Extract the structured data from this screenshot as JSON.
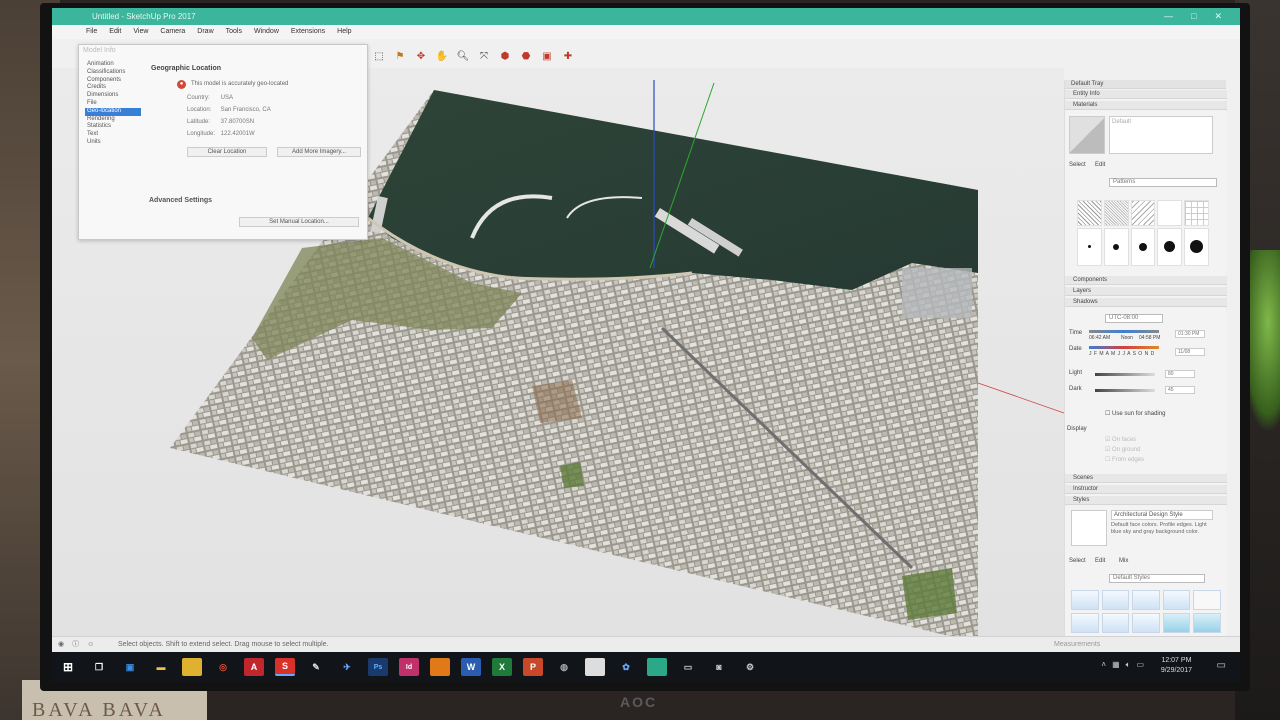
{
  "window": {
    "title": "Untitled - SketchUp Pro 2017",
    "controls": [
      "—",
      "□",
      "✕"
    ]
  },
  "menu": [
    "File",
    "Edit",
    "View",
    "Camera",
    "Draw",
    "Tools",
    "Window",
    "Extensions",
    "Help"
  ],
  "geo_dialog": {
    "title": "Model Info",
    "sections": [
      "Animation",
      "Classifications",
      "Components",
      "Credits",
      "Dimensions",
      "File",
      "Geo-location",
      "Rendering",
      "Statistics",
      "Text",
      "Units"
    ],
    "selected_index": 6,
    "heading": "Geographic Location",
    "status": "This model is accurately geo-located",
    "rows": [
      {
        "label": "Country:",
        "value": "USA"
      },
      {
        "label": "Location:",
        "value": "San Francisco, CA"
      },
      {
        "label": "Latitude:",
        "value": "37.80700SN"
      },
      {
        "label": "Longitude:",
        "value": "122.42001W"
      }
    ],
    "clear_button": "Clear Location",
    "imagery_button": "Add More Imagery...",
    "advanced_heading": "Advanced Settings",
    "manual_button": "Set Manual Location..."
  },
  "tray": {
    "title": "Default Tray",
    "entity_info": "Entity Info",
    "materials": "Materials",
    "material_name": "Default",
    "tabs_select": "Select",
    "tabs_edit": "Edit",
    "materials_dropdown": "Patterns",
    "components": "Components",
    "layers": "Layers",
    "shadows": "Shadows",
    "utc": "UTC-08:00",
    "time_label": "Time",
    "time_start": "06:42 AM",
    "time_mid": "Noon",
    "time_end": "04:58 PM",
    "time_value": "01:30 PM",
    "date_label": "Date",
    "months": "J F M A M J J A S O N D",
    "date_value": "11/08",
    "light_label": "Light",
    "light_value": "80",
    "dark_label": "Dark",
    "dark_value": "45",
    "use_sun": "Use sun for shading",
    "display_label": "Display",
    "display_opts": [
      "On faces",
      "On ground",
      "From edges"
    ],
    "scenes": "Scenes",
    "instructor": "Instructor",
    "styles": "Styles",
    "style_name": "Architectural Design Style",
    "style_desc": "Default face colors. Profile edges. Light blue sky and gray background color.",
    "styles_tab_mix": "Mix",
    "styles_dropdown": "Default Styles"
  },
  "status": {
    "hint": "Select objects. Shift to extend select. Drag mouse to select multiple.",
    "measurements": "Measurements"
  },
  "taskbar": {
    "time": "12:07 PM",
    "date": "9/29/2017"
  },
  "surroundings": {
    "monitor_logo": "AOC",
    "paper_text": "BAVA  BAVA"
  }
}
